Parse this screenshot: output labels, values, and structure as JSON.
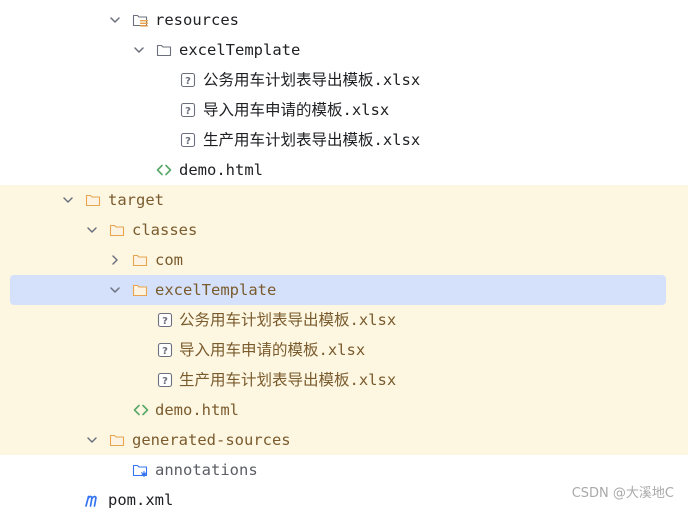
{
  "colors": {
    "excluded_background": "#fdf7e2",
    "excluded_text": "#7a5b2e",
    "selection": "#d5e1fb",
    "folder_icon": "#e8a44e",
    "html_icon": "#59a869",
    "maven_icon": "#3574f0"
  },
  "tree": {
    "resources": "resources",
    "excel_template": "excelTemplate",
    "file_1": "公务用车计划表导出模板.xlsx",
    "file_2": "导入用车申请的模板.xlsx",
    "file_3": "生产用车计划表导出模板.xlsx",
    "demo_html": "demo.html",
    "target": "target",
    "classes": "classes",
    "com": "com",
    "target_excel_template": "excelTemplate",
    "target_file_1": "公务用车计划表导出模板.xlsx",
    "target_file_2": "导入用车申请的模板.xlsx",
    "target_file_3": "生产用车计划表导出模板.xlsx",
    "target_demo_html": "demo.html",
    "generated_sources": "generated-sources",
    "annotations": "annotations",
    "pom_xml": "pom.xml"
  },
  "icons": {
    "expanded": "chevron-down-icon",
    "collapsed": "chevron-right-icon",
    "resources_folder": "resources-folder-icon",
    "folder": "folder-icon",
    "unknown_file": "unknown-file-icon",
    "html_file": "html-file-icon",
    "generated_folder": "generated-sources-folder-icon",
    "maven_file": "maven-icon"
  },
  "watermark": "CSDN @大溪地C"
}
